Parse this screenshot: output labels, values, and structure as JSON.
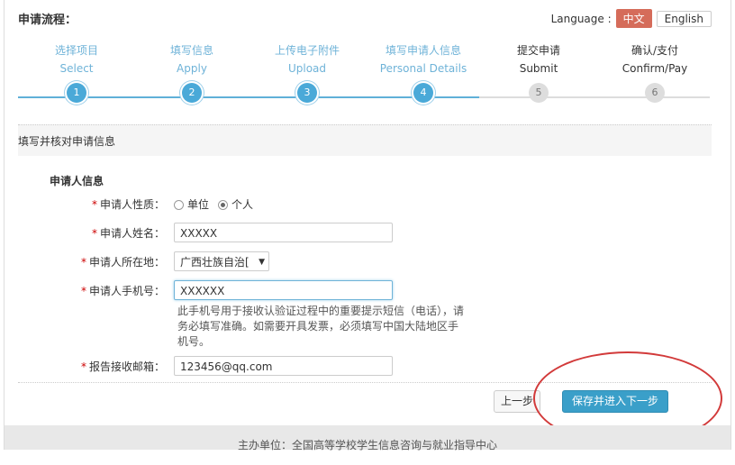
{
  "header": {
    "title": "申请流程：",
    "language_label": "Language :",
    "lang_zh": "中文",
    "lang_en": "English"
  },
  "steps": [
    {
      "cn": "选择项目",
      "en": "Select",
      "num": "1"
    },
    {
      "cn": "填写信息",
      "en": "Apply",
      "num": "2"
    },
    {
      "cn": "上传电子附件",
      "en": "Upload",
      "num": "3"
    },
    {
      "cn": "填写申请人信息",
      "en": "Personal Details",
      "num": "4"
    },
    {
      "cn": "提交申请",
      "en": "Submit",
      "num": "5"
    },
    {
      "cn": "确认/支付",
      "en": "Confirm/Pay",
      "num": "6"
    }
  ],
  "current_step": 4,
  "form": {
    "section_title": "填写并核对申请信息",
    "subtitle": "申请人信息",
    "required_mark": "*",
    "type_label": "申请人性质：",
    "type_opt1": "单位",
    "type_opt2": "个人",
    "name_label": "申请人姓名：",
    "name_value": "XXXXX",
    "region_label": "申请人所在地：",
    "region_value": "广西壮族自治[",
    "phone_label": "申请人手机号：",
    "phone_value": "XXXXXX",
    "phone_hint": "此手机号用于接收认验证过程中的重要提示短信（电话），请务必填写准确。如需要开具发票，必须填写中国大陆地区手机号。",
    "email_label": "报告接收邮箱：",
    "email_value": "123456@qq.com"
  },
  "buttons": {
    "prev": "上一步",
    "next": "保存并进入下一步"
  },
  "footer": "主办单位：全国高等学校学生信息咨询与就业指导中心"
}
